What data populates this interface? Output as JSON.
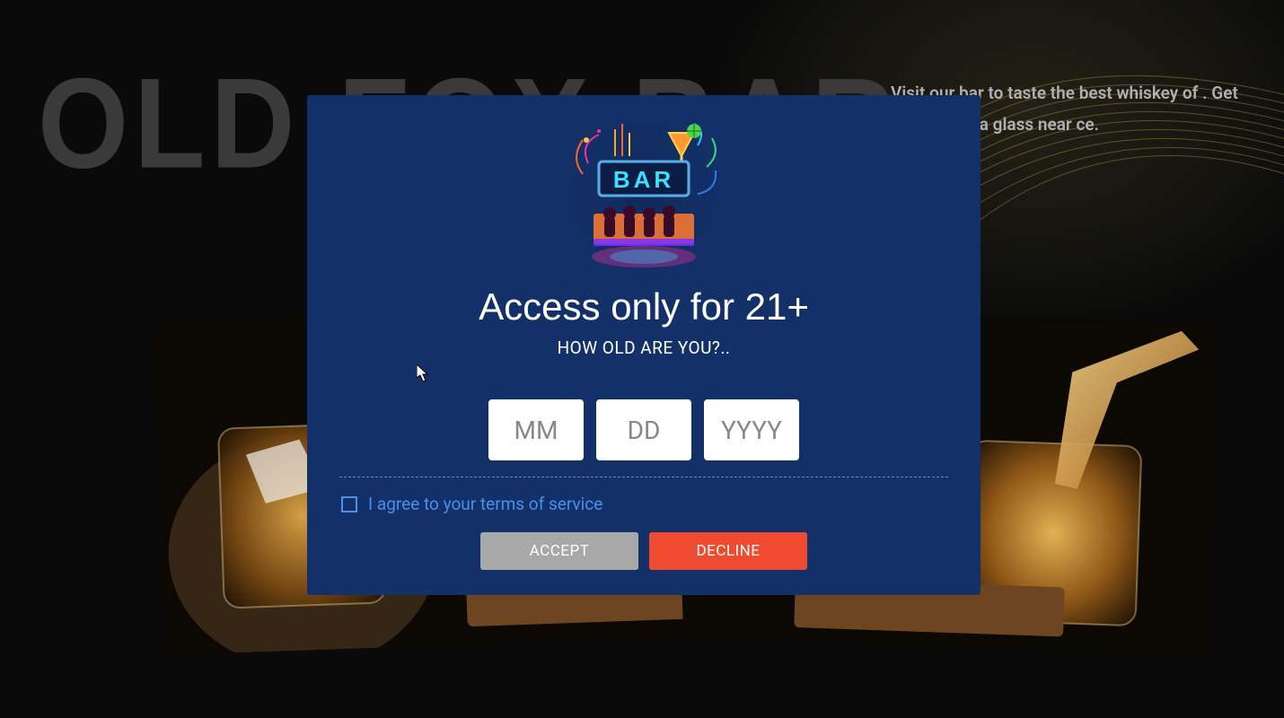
{
  "background": {
    "hero_title": "OLD FOX BAR",
    "blurb": "Visit our bar to taste the best whiskey of . Get comfy with a glass near ce."
  },
  "modal": {
    "logo_text": "BAR",
    "title": "Access only for 21+",
    "subtitle": "HOW OLD ARE YOU?..",
    "fields": {
      "month_placeholder": "MM",
      "day_placeholder": "DD",
      "year_placeholder": "YYYY",
      "month_value": "",
      "day_value": "",
      "year_value": ""
    },
    "terms_label": "I agree to your terms of service",
    "terms_checked": false,
    "accept_label": "ACCEPT",
    "decline_label": "DECLINE"
  }
}
